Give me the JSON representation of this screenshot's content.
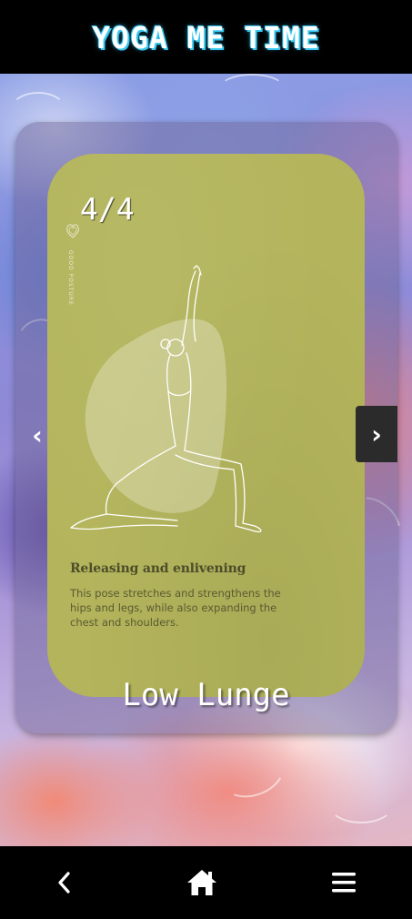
{
  "app": {
    "title": "YOGA ME TIME"
  },
  "carousel": {
    "counter": "4/4",
    "prev_label": "‹",
    "next_label": "›"
  },
  "card": {
    "brand_text": "GOOD POSTURE",
    "heading": "Releasing and enlivening",
    "description": "This pose stretches and strengthens the hips and legs, while also expanding the chest and shoulders.",
    "pose_name": "Low Lunge",
    "card_color": "#b3b45b"
  },
  "bottom_nav": {
    "items": [
      {
        "icon": "back-chevron-icon"
      },
      {
        "icon": "home-icon"
      },
      {
        "icon": "hamburger-menu-icon"
      }
    ]
  },
  "colors": {
    "header_bg": "#000000",
    "title_glow": "#38c6ee",
    "frame_bg": "rgba(110,100,150,0.48)"
  }
}
